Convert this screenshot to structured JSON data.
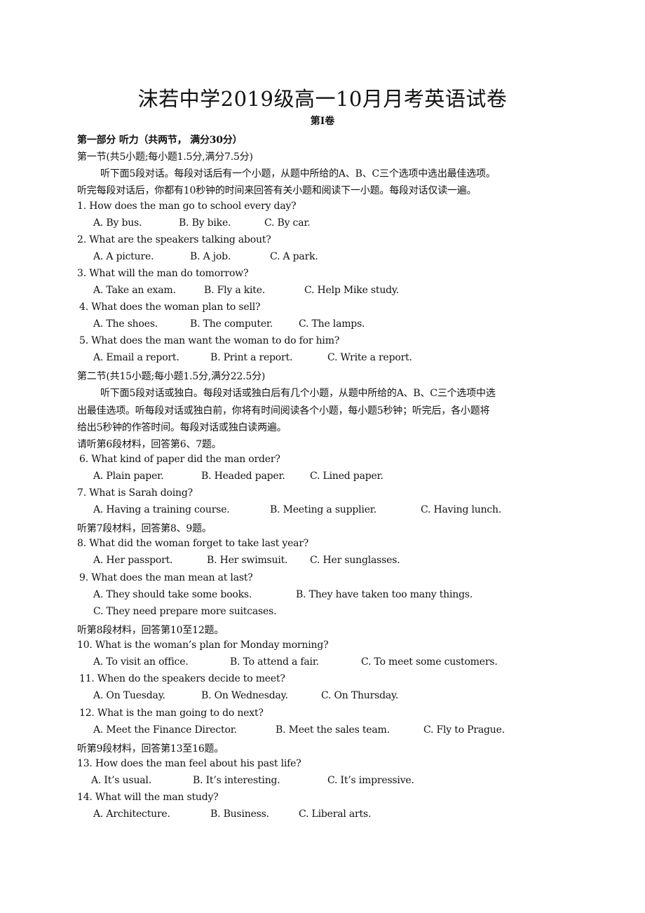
{
  "title": "沫若中学2019级高一10月月考英语试卷",
  "subtitle": "第Ⅰ卷",
  "part1_heading": "第一部分  听力（共两节，  满分30分）",
  "section1": {
    "heading": "第一节(共5小题;每小题1.5分,满分7.5分)",
    "instructions_line1": "听下面5段对话。每段对话后有一个小题，从题中所给的A、B、C三个选项中选出最佳选项。",
    "instructions_line2": "听完每段对话后，你都有10秒钟的时间来回答有关小题和阅读下一小题。每段对话仅读一遍。"
  },
  "section2": {
    "heading": "第二节(共15小题;每小题1.5分,满分22.5分)",
    "instructions_line1": "听下面5段对话或独白。每段对话或独白后有几个小题，从题中所给的A、B、C三个选项中选",
    "instructions_line2": "出最佳选项。听每段对话或独白前，你将有时间阅读各个小题，每小题5秒钟；听完后，各小题将",
    "instructions_line3": "给出5秒钟的作答时间。每段对话或独白读两遍。"
  },
  "material_notes": [
    "请听第6段材料，回答第6、7题。",
    "听第7段材料，回答第8、9题。",
    "听第8段材料，回答第10至12题。",
    "听第9段材料，回答第13至16题。"
  ],
  "questions": [
    {
      "q": "1. How does the man go to school every day?",
      "a": "A. By bus.",
      "b": "B. By bike.",
      "c": "C. By car."
    },
    {
      "q": "2. What are the speakers talking about?",
      "a": "A. A picture.",
      "b": "B. A job.",
      "c": "C. A park."
    },
    {
      "q": "3. What will the man do tomorrow?",
      "a": "A. Take an exam.",
      "b": "B. Fly a kite.",
      "c": "C. Help Mike study."
    },
    {
      "q": "4. What does the woman plan to sell?",
      "a": "A. The shoes.",
      "b": "B. The computer.",
      "c": "C. The lamps."
    },
    {
      "q": "5. What does the man want the woman to do for him?",
      "a": "A. Email a report.",
      "b": "B. Print a report.",
      "c": "C. Write a report."
    },
    {
      "q": "6. What kind of paper did the man order?",
      "a": "A. Plain paper.",
      "b": "B. Headed paper.",
      "c": "C. Lined paper."
    },
    {
      "q": "7. What is Sarah doing?",
      "a": "A. Having a training course.",
      "b": "B. Meeting a supplier.",
      "c": "C. Having lunch."
    },
    {
      "q": "8. What did the woman forget to take last year?",
      "a": "A. Her passport.",
      "b": "B. Her swimsuit.",
      "c": "C. Her sunglasses."
    },
    {
      "q": "9. What does the man mean at last?",
      "a": "A. They should take some books.",
      "b": "B. They have taken too many things.",
      "c": "C. They need prepare more suitcases."
    },
    {
      "q": "10. What is the woman’s plan for Monday morning?",
      "a": "A. To visit an office.",
      "b": "B. To attend a fair.",
      "c": "C. To meet some customers."
    },
    {
      "q": "11. When do the speakers decide to meet?",
      "a": "A. On Tuesday.",
      "b": "B. On Wednesday.",
      "c": "C. On Thursday."
    },
    {
      "q": "12. What is the man going to do next?",
      "a": "A. Meet the Finance Director.",
      "b": "B. Meet the sales team.",
      "c": "C. Fly to Prague."
    },
    {
      "q": "13. How does the man feel about his past life?",
      "a": "A.  It’s usual.",
      "b": "B. It’s interesting.",
      "c": "C. It’s impressive."
    },
    {
      "q": "14. What will the man study?",
      "a": "A. Architecture.",
      "b": "B. Business.",
      "c": "C. Liberal arts."
    }
  ]
}
